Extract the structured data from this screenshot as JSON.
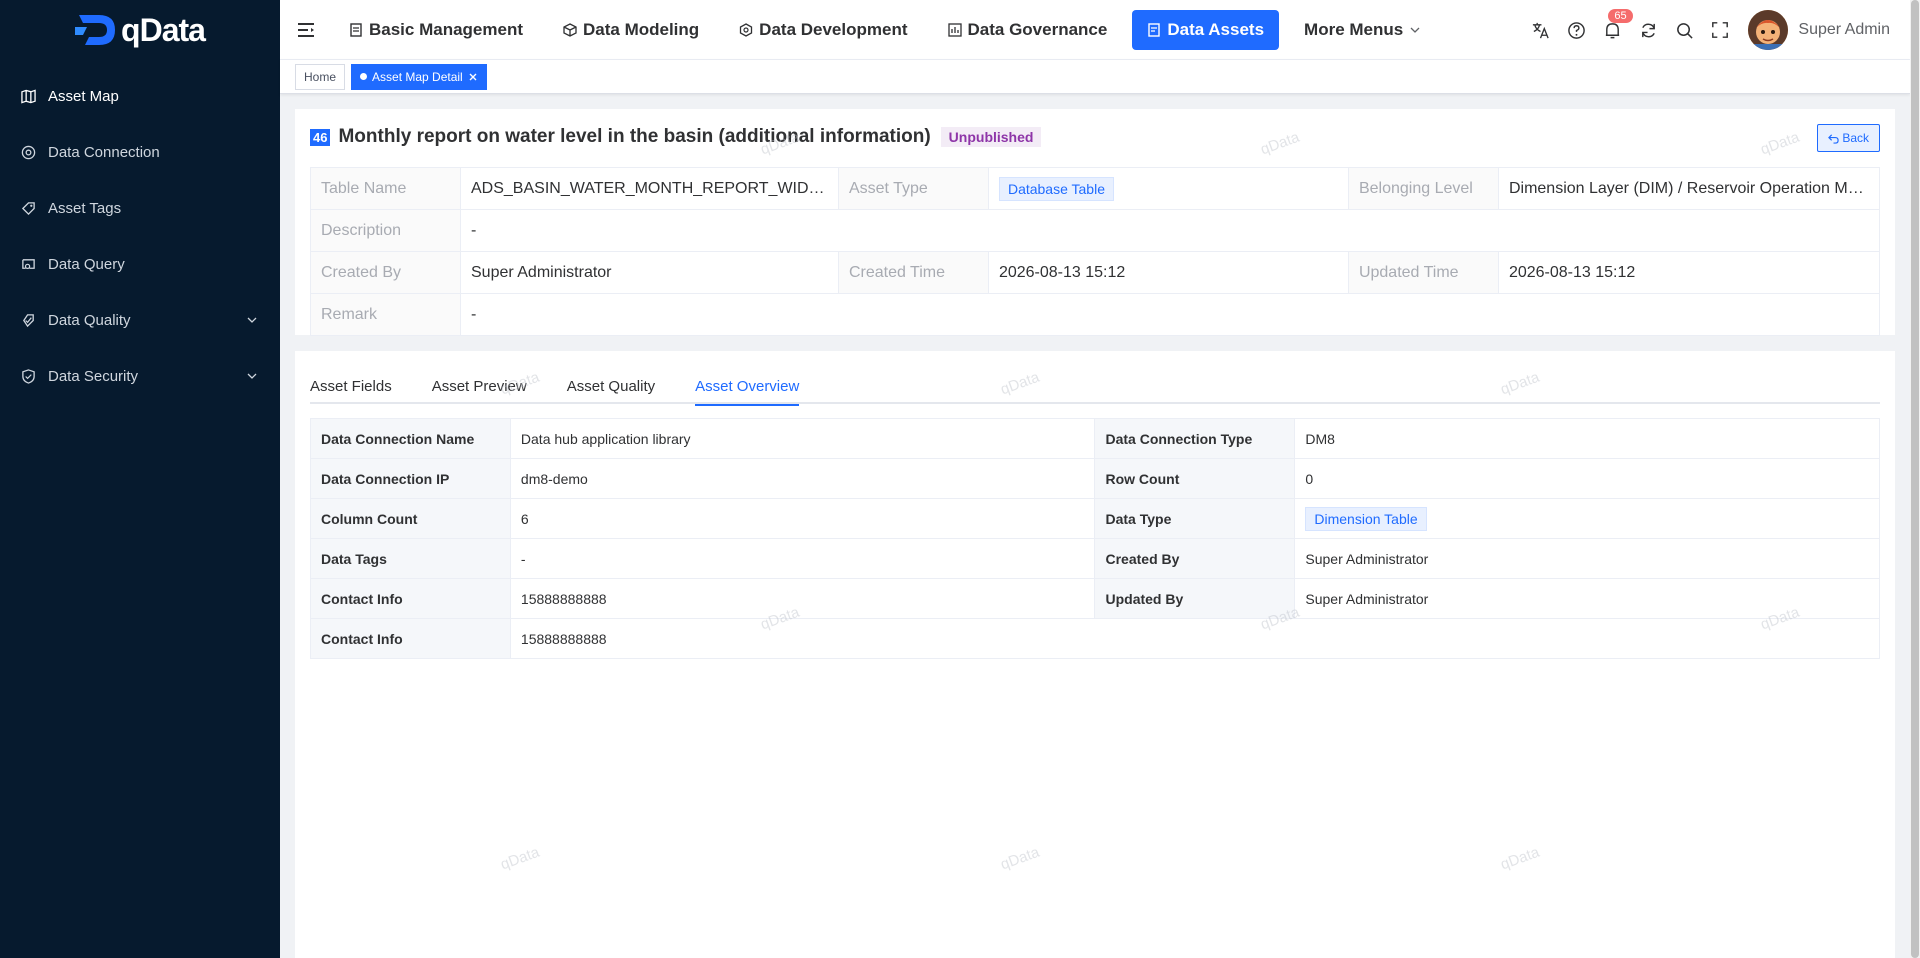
{
  "brand": {
    "name": "qData"
  },
  "sidebar": {
    "items": [
      {
        "label": "Asset Map",
        "icon": "map-icon",
        "active": true
      },
      {
        "label": "Data Connection",
        "icon": "connection-icon"
      },
      {
        "label": "Asset Tags",
        "icon": "tag-icon"
      },
      {
        "label": "Data Query",
        "icon": "query-icon"
      },
      {
        "label": "Data Quality",
        "icon": "quality-icon",
        "expandable": true
      },
      {
        "label": "Data Security",
        "icon": "shield-icon",
        "expandable": true
      }
    ]
  },
  "topnav": {
    "items": [
      {
        "label": "Basic Management",
        "icon": "doc-icon"
      },
      {
        "label": "Data Modeling",
        "icon": "cube-icon"
      },
      {
        "label": "Data Development",
        "icon": "hexagon-icon"
      },
      {
        "label": "Data Governance",
        "icon": "governance-icon"
      },
      {
        "label": "Data Assets",
        "icon": "asset-icon",
        "active": true
      },
      {
        "label": "More Menus",
        "icon": "chevron-down-icon"
      }
    ],
    "notification_count": "65",
    "user_name": "Super Admin"
  },
  "tags": {
    "home": "Home",
    "active": "Asset Map Detail"
  },
  "asset": {
    "number": "46",
    "title": "Monthly report on water level in the basin (additional information)",
    "status": "Unpublished",
    "back_label": "Back"
  },
  "info": {
    "table_name_label": "Table Name",
    "table_name": "ADS_BASIN_WATER_MONTH_REPORT_WIDE_A...",
    "asset_type_label": "Asset Type",
    "asset_type": "Database Table",
    "level_label": "Belonging Level",
    "level": "Dimension Layer (DIM) / Reservoir Operation Moni...",
    "description_label": "Description",
    "description": "-",
    "created_by_label": "Created By",
    "created_by": "Super Administrator",
    "created_time_label": "Created Time",
    "created_time": "2026-08-13 15:12",
    "updated_time_label": "Updated Time",
    "updated_time": "2026-08-13 15:12",
    "remark_label": "Remark",
    "remark": "-"
  },
  "tabs": {
    "items": [
      "Asset Fields",
      "Asset Preview",
      "Asset Quality",
      "Asset Overview"
    ],
    "active_index": 3
  },
  "overview": {
    "rows": [
      {
        "l1": "Data Connection Name",
        "v1": "Data hub application library",
        "l2": "Data Connection Type",
        "v2": "DM8"
      },
      {
        "l1": "Data Connection IP",
        "v1": "dm8-demo",
        "l2": "Row Count",
        "v2": "0"
      },
      {
        "l1": "Column Count",
        "v1": "6",
        "l2": "Data Type",
        "v2": "Dimension Table"
      },
      {
        "l1": "Data Tags",
        "v1": "-",
        "l2": "Created By",
        "v2": "Super Administrator"
      },
      {
        "l1": "Contact Info",
        "v1": "15888888888",
        "l2": "Updated By",
        "v2": "Super Administrator"
      },
      {
        "l1": "Contact Info",
        "v1": "15888888888"
      }
    ]
  },
  "watermark": "qData",
  "colors": {
    "primary": "#1f6bff",
    "sidebar": "#061a2e",
    "status": "#8e35a8",
    "badge": "#f56c6c"
  }
}
